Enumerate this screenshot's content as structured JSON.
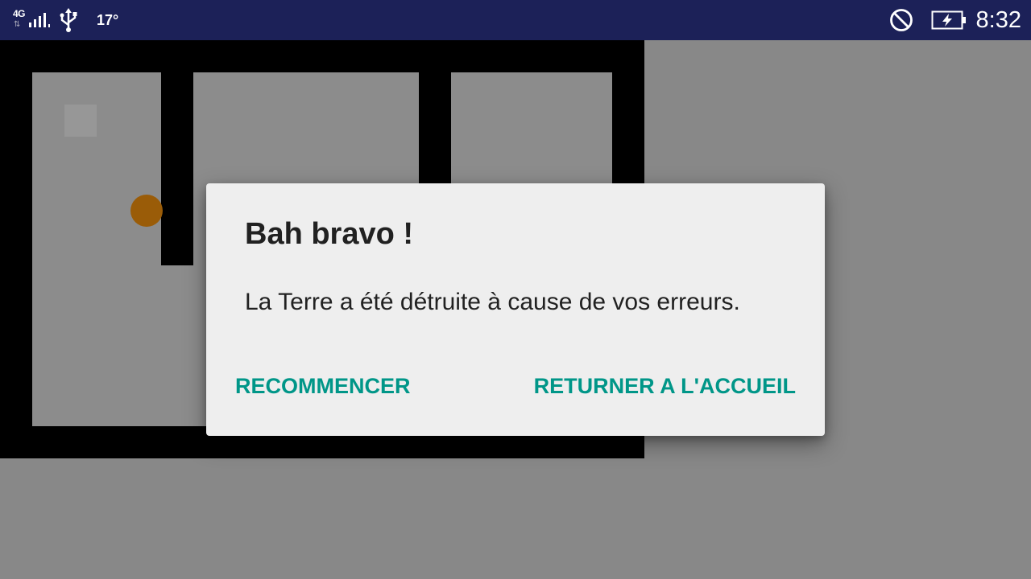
{
  "status_bar": {
    "network": "4G",
    "temperature": "17°",
    "time": "8:32",
    "icons": [
      "signal-icon",
      "usb-icon",
      "do-not-disturb-icon",
      "battery-charging-icon"
    ]
  },
  "colors": {
    "status_bar_bg": "#1c2158",
    "wall": "#000000",
    "floor": "#8c8c8c",
    "ball": "#9a5c08",
    "dialog_bg": "#eeeeee",
    "accent": "#009688"
  },
  "dialog": {
    "title": "Bah bravo !",
    "message": "La Terre a été détruite à cause de vos erreurs.",
    "restart_label": "RECOMMENCER",
    "home_label": "RETURNER A L'ACCUEIL"
  }
}
